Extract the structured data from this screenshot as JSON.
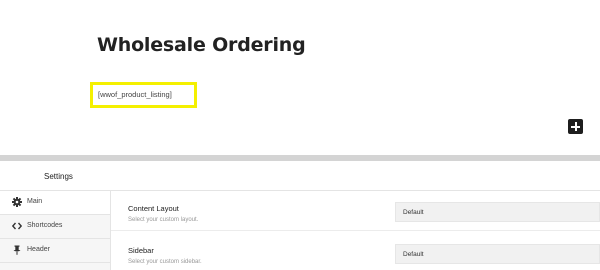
{
  "editor": {
    "title": "Wholesale Ordering",
    "shortcode": "[wwof_product_listing]",
    "add_block_icon": "plus-icon",
    "highlight_color": "#f4f000"
  },
  "settings": {
    "title": "Settings",
    "sidebar": {
      "items": [
        {
          "label": "Main",
          "icon": "gear-icon"
        },
        {
          "label": "Shortcodes",
          "icon": "code-icon"
        },
        {
          "label": "Header",
          "icon": "pin-icon"
        }
      ]
    },
    "rows": [
      {
        "label": "Content Layout",
        "description": "Select your custom layout.",
        "value": "Default"
      },
      {
        "label": "Sidebar",
        "description": "Select your custom sidebar.",
        "value": "Default"
      }
    ]
  }
}
